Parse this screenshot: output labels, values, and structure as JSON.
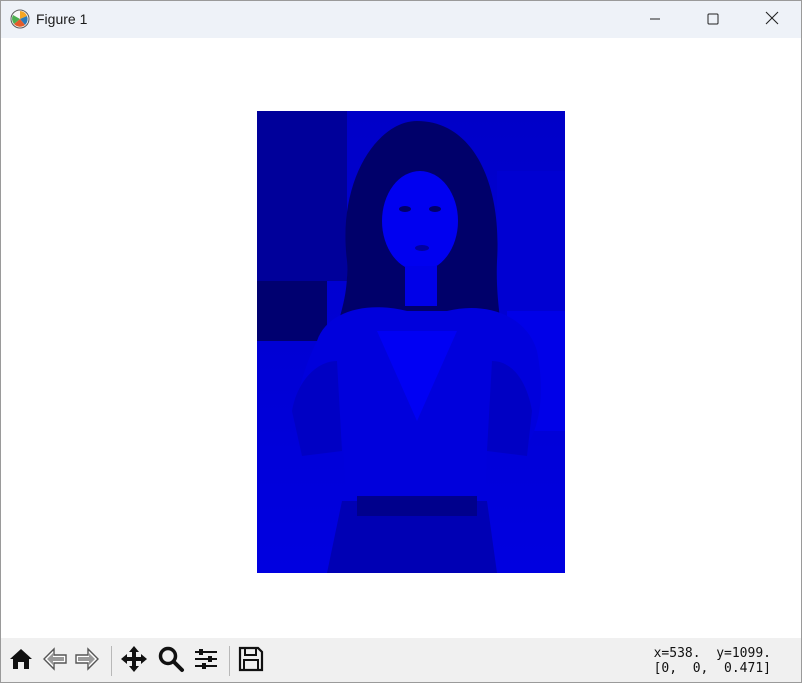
{
  "window": {
    "title": "Figure 1",
    "app_icon": "matplotlib-icon",
    "controls": [
      "minimize-icon",
      "maximize-icon",
      "close-icon"
    ]
  },
  "figure": {
    "image_description_colors": {
      "background": "#ffffff",
      "image_tint": "#0000e6"
    }
  },
  "toolbar": {
    "tools": [
      "home-icon",
      "back-icon",
      "forward-icon",
      "pan-icon",
      "zoom-icon",
      "configure-subplots-icon",
      "save-icon"
    ],
    "coord_line1": "x=538.  y=1099.",
    "coord_line2": "[0,  0,  0.471]"
  }
}
